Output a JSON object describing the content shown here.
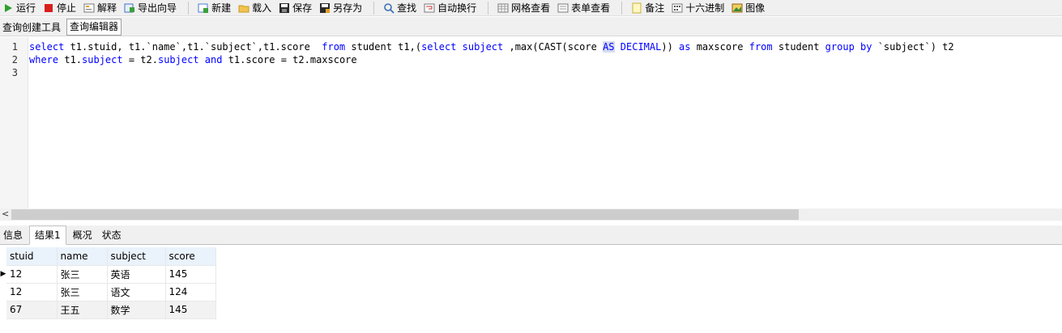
{
  "toolbar": {
    "groups": [
      [
        {
          "id": "run",
          "label": "运行",
          "icon": "play-icon"
        },
        {
          "id": "stop",
          "label": "停止",
          "icon": "stop-icon"
        },
        {
          "id": "explain",
          "label": "解释",
          "icon": "explain-icon"
        },
        {
          "id": "export",
          "label": "导出向导",
          "icon": "export-icon"
        }
      ],
      [
        {
          "id": "new",
          "label": "新建",
          "icon": "new-query-icon"
        },
        {
          "id": "load",
          "label": "载入",
          "icon": "folder-icon"
        },
        {
          "id": "save",
          "label": "保存",
          "icon": "save-icon"
        },
        {
          "id": "save-as",
          "label": "另存为",
          "icon": "save-as-icon"
        }
      ],
      [
        {
          "id": "find",
          "label": "查找",
          "icon": "search-icon"
        },
        {
          "id": "word-wrap",
          "label": "自动换行",
          "icon": "word-wrap-icon"
        }
      ],
      [
        {
          "id": "grid-view",
          "label": "网格查看",
          "icon": "grid-icon"
        },
        {
          "id": "form-view",
          "label": "表单查看",
          "icon": "form-icon"
        }
      ],
      [
        {
          "id": "memo",
          "label": "备注",
          "icon": "memo-icon"
        },
        {
          "id": "hex",
          "label": "十六进制",
          "icon": "hex-icon"
        },
        {
          "id": "image",
          "label": "图像",
          "icon": "image-icon"
        }
      ]
    ]
  },
  "top_tabs": {
    "builder": "查询创建工具",
    "editor": "查询编辑器"
  },
  "editor": {
    "line_numbers": [
      "1",
      "2",
      "3"
    ],
    "lines": [
      [
        {
          "t": "select",
          "k": "kw"
        },
        {
          "t": " t1.stuid, t1.`name`,t1.`subject`,t1.score  "
        },
        {
          "t": "from",
          "k": "kw"
        },
        {
          "t": " student t1,("
        },
        {
          "t": "select",
          "k": "kw"
        },
        {
          "t": " "
        },
        {
          "t": "subject",
          "k": "kw"
        },
        {
          "t": " ,max(CAST(score "
        },
        {
          "t": "AS",
          "k": "kw hl"
        },
        {
          "t": " "
        },
        {
          "t": "DECIMAL",
          "k": "kw"
        },
        {
          "t": ")) "
        },
        {
          "t": "as",
          "k": "kw"
        },
        {
          "t": " maxscore "
        },
        {
          "t": "from",
          "k": "kw"
        },
        {
          "t": " student "
        },
        {
          "t": "group by",
          "k": "kw"
        },
        {
          "t": " `subject`) t2"
        }
      ],
      [
        {
          "t": "where",
          "k": "kw"
        },
        {
          "t": " t1."
        },
        {
          "t": "subject",
          "k": "kw"
        },
        {
          "t": " = t2."
        },
        {
          "t": "subject",
          "k": "kw"
        },
        {
          "t": " "
        },
        {
          "t": "and",
          "k": "kw"
        },
        {
          "t": " t1.score = t2.maxscore"
        }
      ],
      []
    ]
  },
  "scroll": {
    "left_arrow": "<"
  },
  "result_tabs": {
    "info": "信息",
    "result1": "结果1",
    "profile": "概况",
    "status": "状态"
  },
  "results": {
    "columns": [
      "stuid",
      "name",
      "subject",
      "score"
    ],
    "rows": [
      [
        "12",
        "张三",
        "英语",
        "145"
      ],
      [
        "12",
        "张三",
        "语文",
        "124"
      ],
      [
        "67",
        "王五",
        "数学",
        "145"
      ]
    ],
    "current_row_marker": "▶"
  }
}
